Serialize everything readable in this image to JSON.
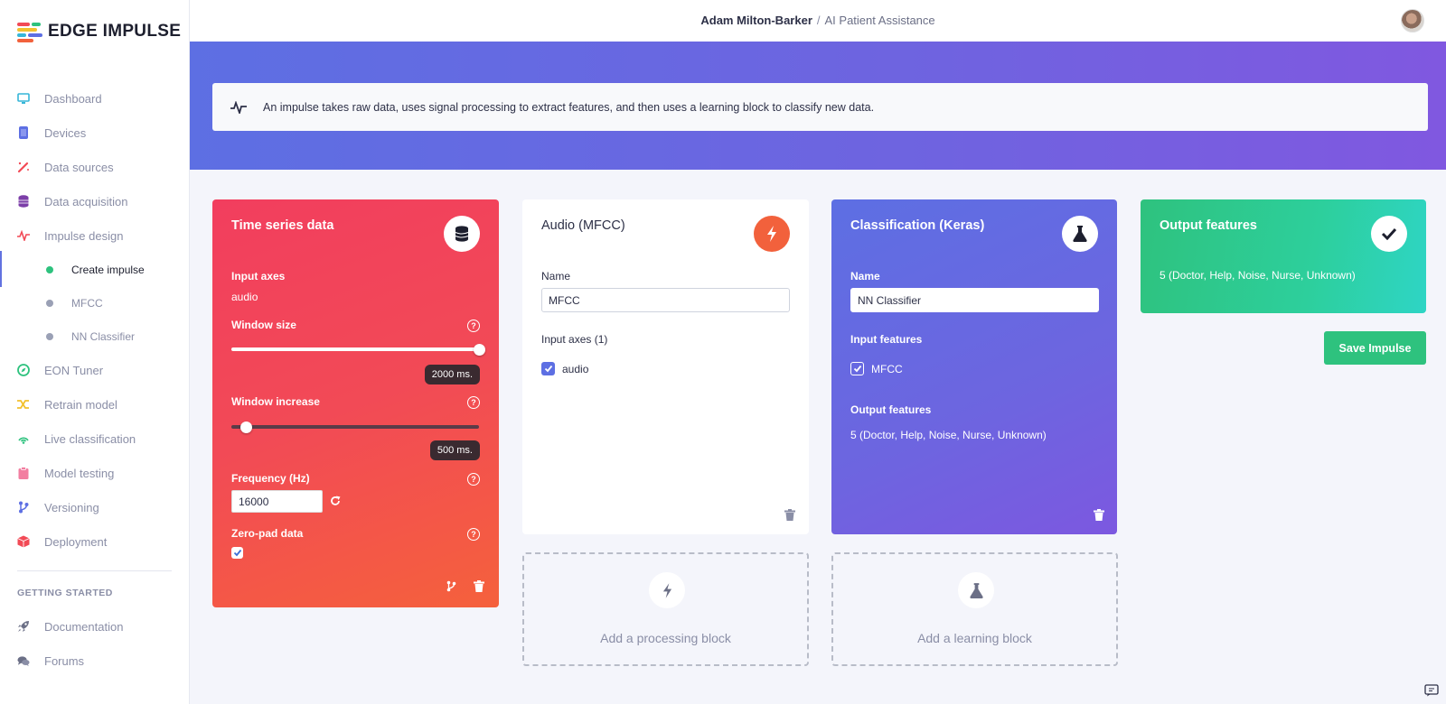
{
  "app": {
    "logo_text": "EDGE IMPULSE"
  },
  "sidebar": {
    "items": [
      {
        "label": "Dashboard",
        "icon": "monitor-icon",
        "color": "#36b6d8"
      },
      {
        "label": "Devices",
        "icon": "cpu-icon",
        "color": "#5d6fe3"
      },
      {
        "label": "Data sources",
        "icon": "magic-wand-icon",
        "color": "#f24a56"
      },
      {
        "label": "Data acquisition",
        "icon": "database-icon",
        "color": "#7c3ea8"
      },
      {
        "label": "Impulse design",
        "icon": "pulse-icon",
        "color": "#f24a56"
      }
    ],
    "sub_items": [
      {
        "label": "Create impulse",
        "active": true
      },
      {
        "label": "MFCC",
        "active": false
      },
      {
        "label": "NN Classifier",
        "active": false
      }
    ],
    "items_after": [
      {
        "label": "EON Tuner",
        "icon": "compass-icon",
        "color": "#2ec27e"
      },
      {
        "label": "Retrain model",
        "icon": "shuffle-icon",
        "color": "#f2c12e"
      },
      {
        "label": "Live classification",
        "icon": "broadcast-icon",
        "color": "#2ec27e"
      },
      {
        "label": "Model testing",
        "icon": "clipboard-icon",
        "color": "#f27ea0"
      },
      {
        "label": "Versioning",
        "icon": "branch-icon",
        "color": "#5d6fe3"
      },
      {
        "label": "Deployment",
        "icon": "box-icon",
        "color": "#f24a56"
      }
    ],
    "heading": "GETTING STARTED",
    "getting_started": [
      {
        "label": "Documentation",
        "icon": "rocket-icon"
      },
      {
        "label": "Forums",
        "icon": "comments-icon"
      }
    ]
  },
  "header": {
    "user": "Adam Milton-Barker",
    "separator": "/",
    "project": "AI Patient Assistance"
  },
  "info_banner": "An impulse takes raw data, uses signal processing to extract features, and then uses a learning block to classify new data.",
  "time_series": {
    "title": "Time series data",
    "input_axes_label": "Input axes",
    "input_axes_value": "audio",
    "window_size_label": "Window size",
    "window_size_value": "2000 ms.",
    "window_size_fraction": 1.0,
    "window_increase_label": "Window increase",
    "window_increase_value": "500 ms.",
    "window_increase_fraction": 0.06,
    "frequency_label": "Frequency (Hz)",
    "frequency_value": "16000",
    "zero_pad_label": "Zero-pad data",
    "zero_pad_checked": true
  },
  "mfcc_block": {
    "title": "Audio (MFCC)",
    "name_label": "Name",
    "name_value": "MFCC",
    "input_axes_label": "Input axes (1)",
    "axis_option": "audio"
  },
  "keras_block": {
    "title": "Classification (Keras)",
    "name_label": "Name",
    "name_value": "NN Classifier",
    "input_features_label": "Input features",
    "input_feature_option": "MFCC",
    "output_features_label": "Output features",
    "output_features_value": "5 (Doctor, Help, Noise, Nurse, Unknown)"
  },
  "output_block": {
    "title": "Output features",
    "value": "5 (Doctor, Help, Noise, Nurse, Unknown)"
  },
  "save_button": "Save Impulse",
  "add_processing": "Add a processing block",
  "add_learning": "Add a learning block",
  "colors": {
    "accent": "#5d6fe3",
    "success": "#2ec27e",
    "danger": "#f24a56",
    "processing": "#f2613c"
  }
}
